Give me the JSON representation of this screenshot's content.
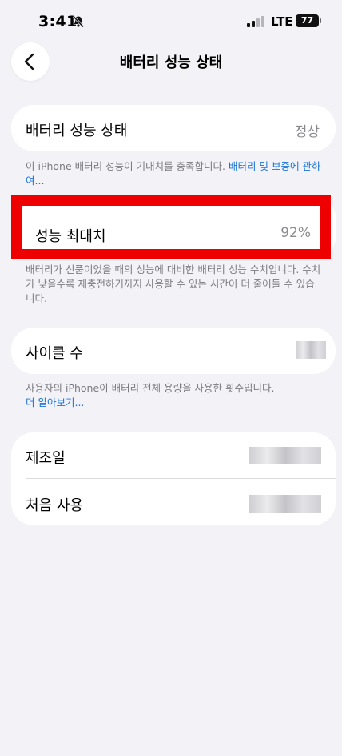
{
  "status_bar": {
    "time": "3:41",
    "network": "LTE",
    "battery": "77"
  },
  "nav": {
    "title": "배터리 성능 상태"
  },
  "health": {
    "label": "배터리 성능 상태",
    "value": "정상",
    "note_text": "이 iPhone 배터리 성능이 기대치를 충족합니다. ",
    "note_link": "배터리 및 보증에 관하여..."
  },
  "max_capacity": {
    "label": "성능 최대치",
    "value": "92%",
    "note_text": "배터리가 신품이었을 때의 성능에 대비한 배터리 성능 수치입니다. 수치가 낮을수록 재충전하기까지 사용할 수 있는 시간이 더 줄어들 수 있습니다."
  },
  "cycle": {
    "label": "사이클 수",
    "note_text": "사용자의 iPhone이 배터리 전체 용량을 사용한 횟수입니다.",
    "note_link": "더 알아보기..."
  },
  "dates": {
    "manufactured_label": "제조일",
    "first_use_label": "처음 사용"
  },
  "colors": {
    "highlight": "#ee0000",
    "link": "#1a74d6",
    "background": "#f2f2f7"
  }
}
